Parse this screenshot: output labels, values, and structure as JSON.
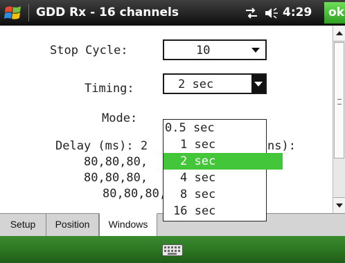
{
  "titlebar": {
    "title": "GDD Rx - 16 channels",
    "clock": "4:29",
    "ok_label": "ok"
  },
  "form": {
    "stop_cycle_label": "Stop Cycle:",
    "stop_cycle_value": "10",
    "timing_label": "Timing:",
    "timing_value": "2 sec",
    "mode_label": "Mode:",
    "delay_text_left": "Delay (ms): 2",
    "delay_text_right": "ns):",
    "row1": "80,80,80,",
    "row2": "80,80,80,",
    "row3": "80,80,80,80,80,80"
  },
  "timing_dropdown": {
    "options": [
      "0.5 sec",
      "1 sec",
      "2 sec",
      "4 sec",
      "8 sec",
      "16 sec"
    ],
    "selected_index": 2
  },
  "tabs": [
    "Setup",
    "Position",
    "Windows"
  ],
  "active_tab": "Windows",
  "colors": {
    "accent_green": "#44c63a",
    "title_bar": "#1a1a1a",
    "bottom_bar": "#2e7a24"
  }
}
